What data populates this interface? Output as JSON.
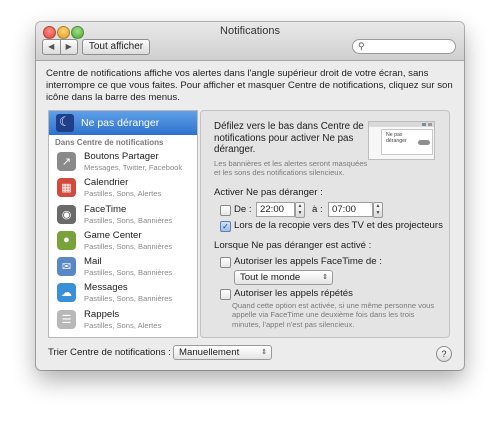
{
  "window": {
    "title": "Notifications"
  },
  "toolbar": {
    "back_glyph": "◀",
    "forward_glyph": "▶",
    "show_all_label": "Tout afficher",
    "search_placeholder": "",
    "search_icon": "search-icon"
  },
  "intro_text": "Centre de notifications affiche vos alertes dans l'angle supérieur droit de votre écran, sans interrompre ce que vous faites. Pour afficher et masquer Centre de notifications, cliquez sur son icône dans la barre des menus.",
  "sidebar": {
    "dnd_label": "Ne pas déranger",
    "section_title": "Dans Centre de notifications",
    "apps": [
      {
        "name": "Boutons Partager",
        "sub": "Messages, Twitter, Facebook",
        "icon": "share-icon",
        "color": "#8a8a8a"
      },
      {
        "name": "Calendrier",
        "sub": "Pastilles, Sons, Alertes",
        "icon": "calendar-icon",
        "color": "#d24a3c"
      },
      {
        "name": "FaceTime",
        "sub": "Pastilles, Sons, Bannières",
        "icon": "facetime-icon",
        "color": "#6a6a6a"
      },
      {
        "name": "Game Center",
        "sub": "Pastilles, Sons, Bannières",
        "icon": "game-center-icon",
        "color": "#7aa23a"
      },
      {
        "name": "Mail",
        "sub": "Pastilles, Sons, Bannières",
        "icon": "mail-icon",
        "color": "#5a87c6"
      },
      {
        "name": "Messages",
        "sub": "Pastilles, Sons, Bannières",
        "icon": "messages-icon",
        "color": "#3a8fd9"
      },
      {
        "name": "Rappels",
        "sub": "Pastilles, Sons, Alertes",
        "icon": "reminders-icon",
        "color": "#b8b8b8"
      }
    ]
  },
  "panel": {
    "heading": "Défilez vers le bas dans Centre de notifications pour activer Ne pas déranger.",
    "subtext": "Les bannières et les alertes seront masquées et les sons des notifications silencieux.",
    "preview_text": "Ne pas déranger",
    "activate_label": "Activer Ne pas déranger :",
    "schedule": {
      "from_label": "De :",
      "from_time": "22:00",
      "to_label": "à :",
      "to_time": "07:00",
      "checked": false
    },
    "mirroring": {
      "label": "Lors de la recopie vers des TV et des projecteurs",
      "checked": true
    },
    "when_active_label": "Lorsque Ne pas déranger est activé :",
    "facetime_calls": {
      "label": "Autoriser les appels FaceTime de :",
      "checked": false
    },
    "caller_popup": "Tout le monde",
    "repeated_calls": {
      "label": "Autoriser les appels répétés",
      "checked": false
    },
    "note": "Quand cette option est activée, si une même personne vous appelle via FaceTime une deuxième fois dans les trois minutes, l'appel n'est pas silencieux."
  },
  "footer": {
    "sort_label": "Trier Centre de notifications :",
    "sort_value": "Manuellement",
    "help_glyph": "?"
  },
  "colors": {
    "selection": "#2d71cf",
    "panel_bg": "#e4e4e4",
    "window_bg": "#ececec"
  }
}
